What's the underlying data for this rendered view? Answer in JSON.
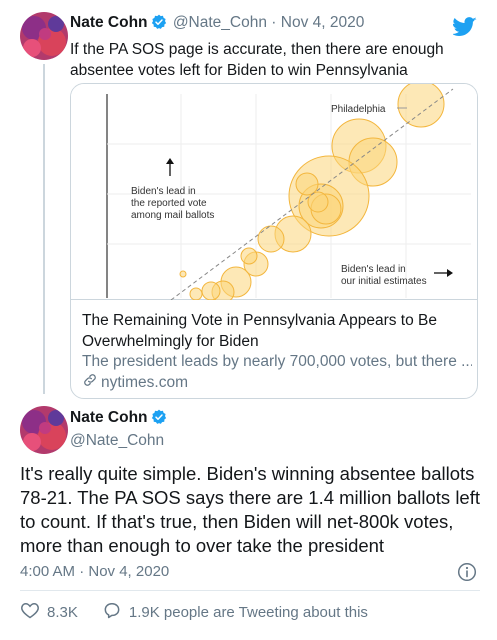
{
  "tweet1": {
    "name": "Nate Cohn",
    "handle": "@Nate_Cohn",
    "separator": "·",
    "date": "Nov 4, 2020",
    "text": "If the PA SOS page is accurate, then there are enough absentee votes left for Biden to win Pennsylvania",
    "card": {
      "title": "The Remaining Vote in Pennsylvania Appears to Be Overwhelmingly for Biden",
      "description": "The president leads by nearly 700,000 votes, but there ...",
      "domain": "nytimes.com",
      "chart": {
        "label_philadelphia": "Philadelphia",
        "label_y": [
          "Biden's lead in",
          "the reported vote",
          "among mail ballots"
        ],
        "label_x": [
          "Biden's lead in",
          "our initial estimates"
        ]
      }
    }
  },
  "tweet2": {
    "name": "Nate Cohn",
    "handle": "@Nate_Cohn",
    "text": "It's really quite simple. Biden's winning absentee ballots 78-21. The PA SOS says there are 1.4 million ballots left to count. If that's true, then Biden will net-800k votes, more than enough to over take the president",
    "time": "4:00 AM · Nov 4, 2020",
    "likes": "8.3K",
    "conversation": "1.9K people are Tweeting about this"
  },
  "colors": {
    "verified": "#1da1f2",
    "bubble_fill": "#fbd67a",
    "bubble_stroke": "#f3b63d",
    "secondary_text": "#657786"
  }
}
